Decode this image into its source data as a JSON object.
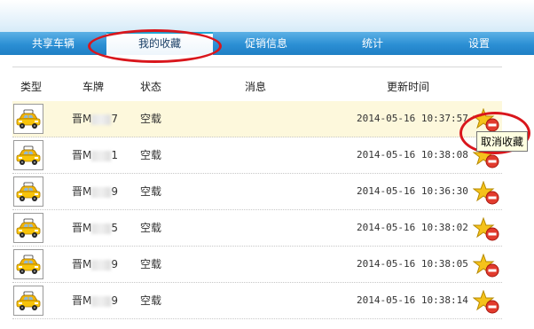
{
  "nav": {
    "items": [
      {
        "label": "共享车辆",
        "active": false
      },
      {
        "label": "我的收藏",
        "active": true
      },
      {
        "label": "促销信息",
        "active": false
      },
      {
        "label": "统计",
        "active": false
      },
      {
        "label": "设置",
        "active": false
      }
    ]
  },
  "table": {
    "headers": {
      "type": "类型",
      "plate": "车牌",
      "status": "状态",
      "message": "消息",
      "time": "更新时间"
    },
    "rows": [
      {
        "plate_prefix": "晋M",
        "plate_suffix": "7",
        "status": "空载",
        "message": "",
        "time": "2014-05-16 10:37:57",
        "highlighted": true
      },
      {
        "plate_prefix": "晋M",
        "plate_suffix": "1",
        "status": "空载",
        "message": "",
        "time": "2014-05-16 10:38:08",
        "highlighted": false
      },
      {
        "plate_prefix": "晋M",
        "plate_suffix": "9",
        "status": "空载",
        "message": "",
        "time": "2014-05-16 10:36:30",
        "highlighted": false
      },
      {
        "plate_prefix": "晋M",
        "plate_suffix": "5",
        "status": "空载",
        "message": "",
        "time": "2014-05-16 10:38:02",
        "highlighted": false
      },
      {
        "plate_prefix": "晋M",
        "plate_suffix": "9",
        "status": "空载",
        "message": "",
        "time": "2014-05-16 10:38:05",
        "highlighted": false
      },
      {
        "plate_prefix": "晋M",
        "plate_suffix": "9",
        "status": "空载",
        "message": "",
        "time": "2014-05-16 10:38:14",
        "highlighted": false
      }
    ]
  },
  "tooltip": {
    "text": "取消收藏"
  },
  "icons": {
    "vehicle": "taxi-icon",
    "favorite": "star-icon",
    "remove": "remove-icon"
  },
  "colors": {
    "nav_blue": "#2b8fd4",
    "highlight_row": "#fdf8dc",
    "annotation_red": "#d9161c",
    "star": "#f5c21b"
  }
}
